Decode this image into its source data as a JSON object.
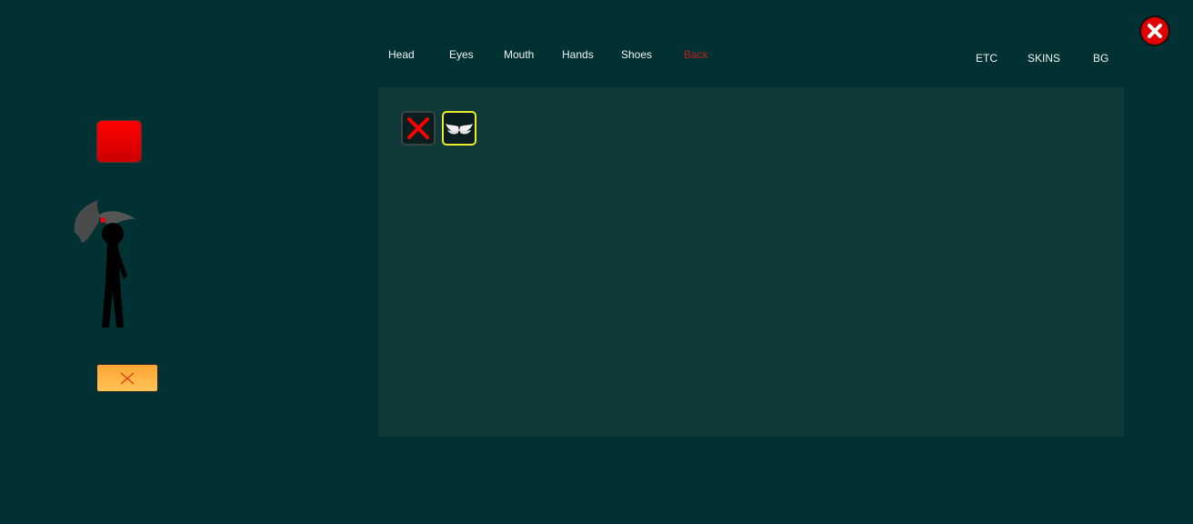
{
  "tabs": [
    {
      "label": "Head"
    },
    {
      "label": "Eyes"
    },
    {
      "label": "Mouth"
    },
    {
      "label": "Hands"
    },
    {
      "label": "Shoes"
    },
    {
      "label": "Back",
      "active": true
    }
  ],
  "right_tabs": [
    {
      "label": "ETC"
    },
    {
      "label": "SKINS"
    },
    {
      "label": "BG"
    }
  ],
  "items": [
    {
      "icon": "none-x-icon"
    },
    {
      "icon": "wings-icon",
      "selected": true
    }
  ],
  "colors": {
    "background": "#013133",
    "panel": "#0f3a39",
    "active_tab": "#c0201a",
    "selected_border": "#e8ec2a",
    "swatch": "#e00000"
  }
}
